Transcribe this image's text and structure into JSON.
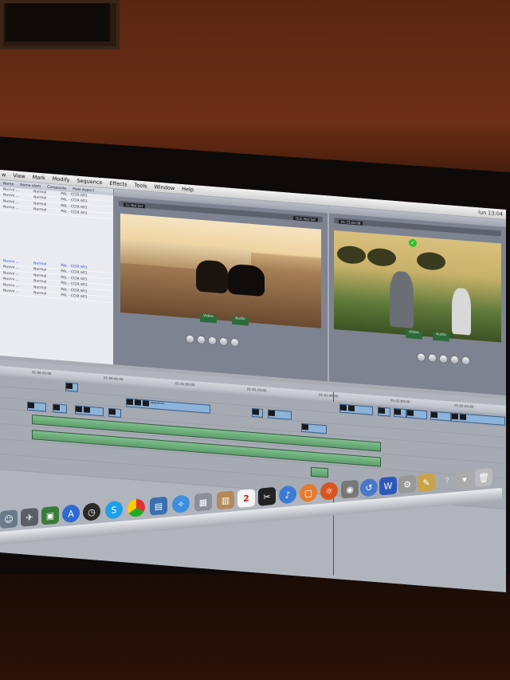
{
  "menu": {
    "items": [
      "w",
      "View",
      "Mark",
      "Modify",
      "Sequence",
      "Effects",
      "Tools",
      "Window",
      "Help"
    ],
    "clock": "lun 13:04"
  },
  "browser": {
    "headers": [
      "Nome",
      "Nome elem",
      "Composite",
      "Pixel Aspect"
    ],
    "rows": [
      {
        "name": "Nuovo ...",
        "mode": "Normal",
        "aspect": "PAL - CCIR 601",
        "selected": false
      },
      {
        "name": "Nuovo ...",
        "mode": "Normal",
        "aspect": "PAL - CCIR 601",
        "selected": false
      },
      {
        "name": "Nuovo ...",
        "mode": "Normal",
        "aspect": "PAL - CCIR 601",
        "selected": false
      },
      {
        "name": "Nuovo ...",
        "mode": "Normal",
        "aspect": "PAL - CCIR 601",
        "selected": false
      },
      {
        "name": "Nuovo ...",
        "mode": "Normal",
        "aspect": "PAL - CCIR 601",
        "selected": true
      },
      {
        "name": "Nuovo ...",
        "mode": "Normal",
        "aspect": "PAL - CCIR 601",
        "selected": false
      },
      {
        "name": "Nuovo ...",
        "mode": "Normal",
        "aspect": "PAL - CCIR 601",
        "selected": false
      },
      {
        "name": "Nuovo ...",
        "mode": "Normal",
        "aspect": "PAL - CCIR 601",
        "selected": false
      },
      {
        "name": "Nuovo ...",
        "mode": "Normal",
        "aspect": "PAL - CCIR 601",
        "selected": false
      },
      {
        "name": "Nuovo ...",
        "mode": "Normal",
        "aspect": "PAL - CCIR 601",
        "selected": false
      }
    ]
  },
  "viewer": {
    "in_label": "In: Not Set",
    "out_label": "Out: Not Set",
    "video_label": "Video",
    "audio_label": "Audio"
  },
  "canvas": {
    "timecode": "01:23:00:08",
    "video_label": "Video",
    "audio_label": "Audio"
  },
  "timeline": {
    "ruler_ticks": [
      "01:00:20:00",
      "01:00:40:00",
      "01:01:00:00",
      "01:01:20:00",
      "01:01:40:00",
      "01:02:00:00",
      "01:02:20:00"
    ],
    "clip_label": "sequenza"
  },
  "dock": {
    "icons": [
      "finder-icon",
      "launchpad-icon",
      "app-store-icon",
      "dashboard-icon",
      "skype-icon",
      "chrome-icon",
      "preview-icon",
      "safari-icon",
      "photos-icon",
      "contacts-icon",
      "calendar-icon",
      "final-cut-icon",
      "itunes-icon",
      "ibooks-icon",
      "firefox-icon",
      "camera-icon",
      "network-icon",
      "word-icon",
      "system-prefs-icon",
      "trash-icon"
    ],
    "calendar_day": "2"
  }
}
